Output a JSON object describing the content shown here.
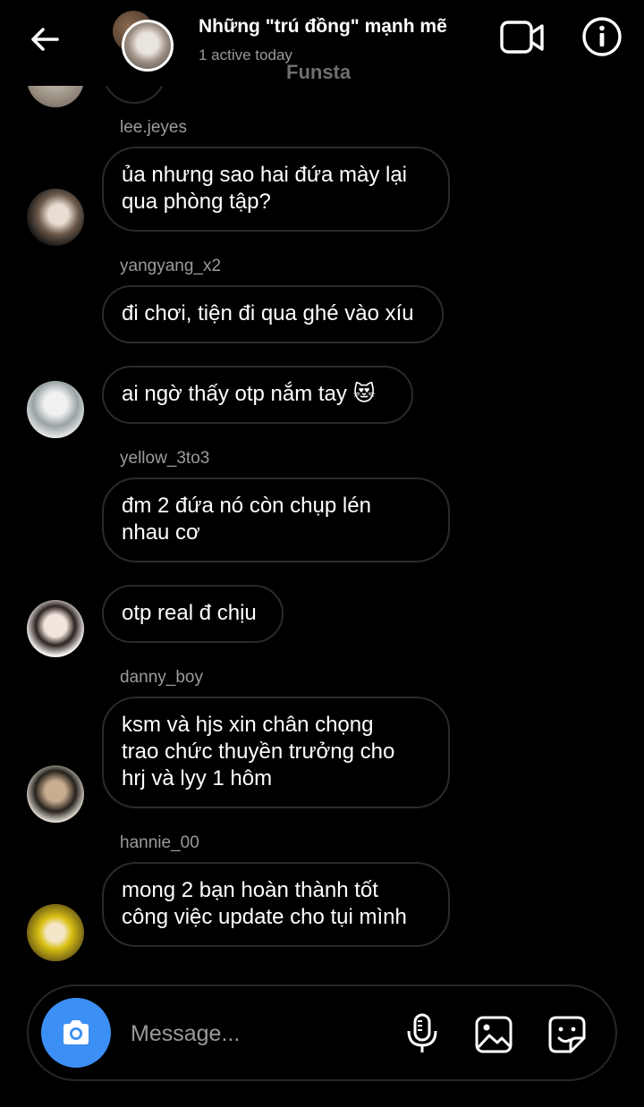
{
  "header": {
    "title": "Những \"trú đồng\" mạnh mẽ",
    "status": "1 active today",
    "watermark": "Funsta"
  },
  "messages": [
    {
      "sender": "lee.jeyes",
      "lines": [
        "ủa nhưng sao hai đứa mày lại",
        "qua phòng tập?"
      ]
    },
    {
      "sender": "yangyang_x2",
      "lines": [
        "đi chơi, tiện đi qua ghé vào xíu"
      ]
    },
    {
      "sender": "",
      "lines": [
        "ai ngờ thấy otp nắm tay 😻"
      ]
    },
    {
      "sender": "yellow_3to3",
      "lines": [
        "đm 2 đứa nó còn chụp lén",
        "nhau cơ"
      ]
    },
    {
      "sender": "",
      "lines": [
        "otp real đ chịu"
      ]
    },
    {
      "sender": "danny_boy",
      "lines": [
        "ksm và hjs xin chân chọng",
        "trao chức thuyền trưởng cho",
        "hrj và lyy 1 hôm"
      ]
    },
    {
      "sender": "hannie_00",
      "lines": [
        "mong 2 bạn hoàn thành tốt",
        "công việc update cho tụi mình"
      ]
    }
  ],
  "composer": {
    "placeholder": "Message..."
  },
  "icons": {
    "back": "arrow-left-icon",
    "video": "video-call-icon",
    "info": "info-icon",
    "camera": "camera-icon",
    "mic": "microphone-icon",
    "gallery": "image-gallery-icon",
    "sticker": "sticker-icon"
  },
  "colors": {
    "background": "#000000",
    "bubble_border": "#2b2b2b",
    "camera_button": "#3b8ff5",
    "secondary_text": "#9b9b9b"
  }
}
